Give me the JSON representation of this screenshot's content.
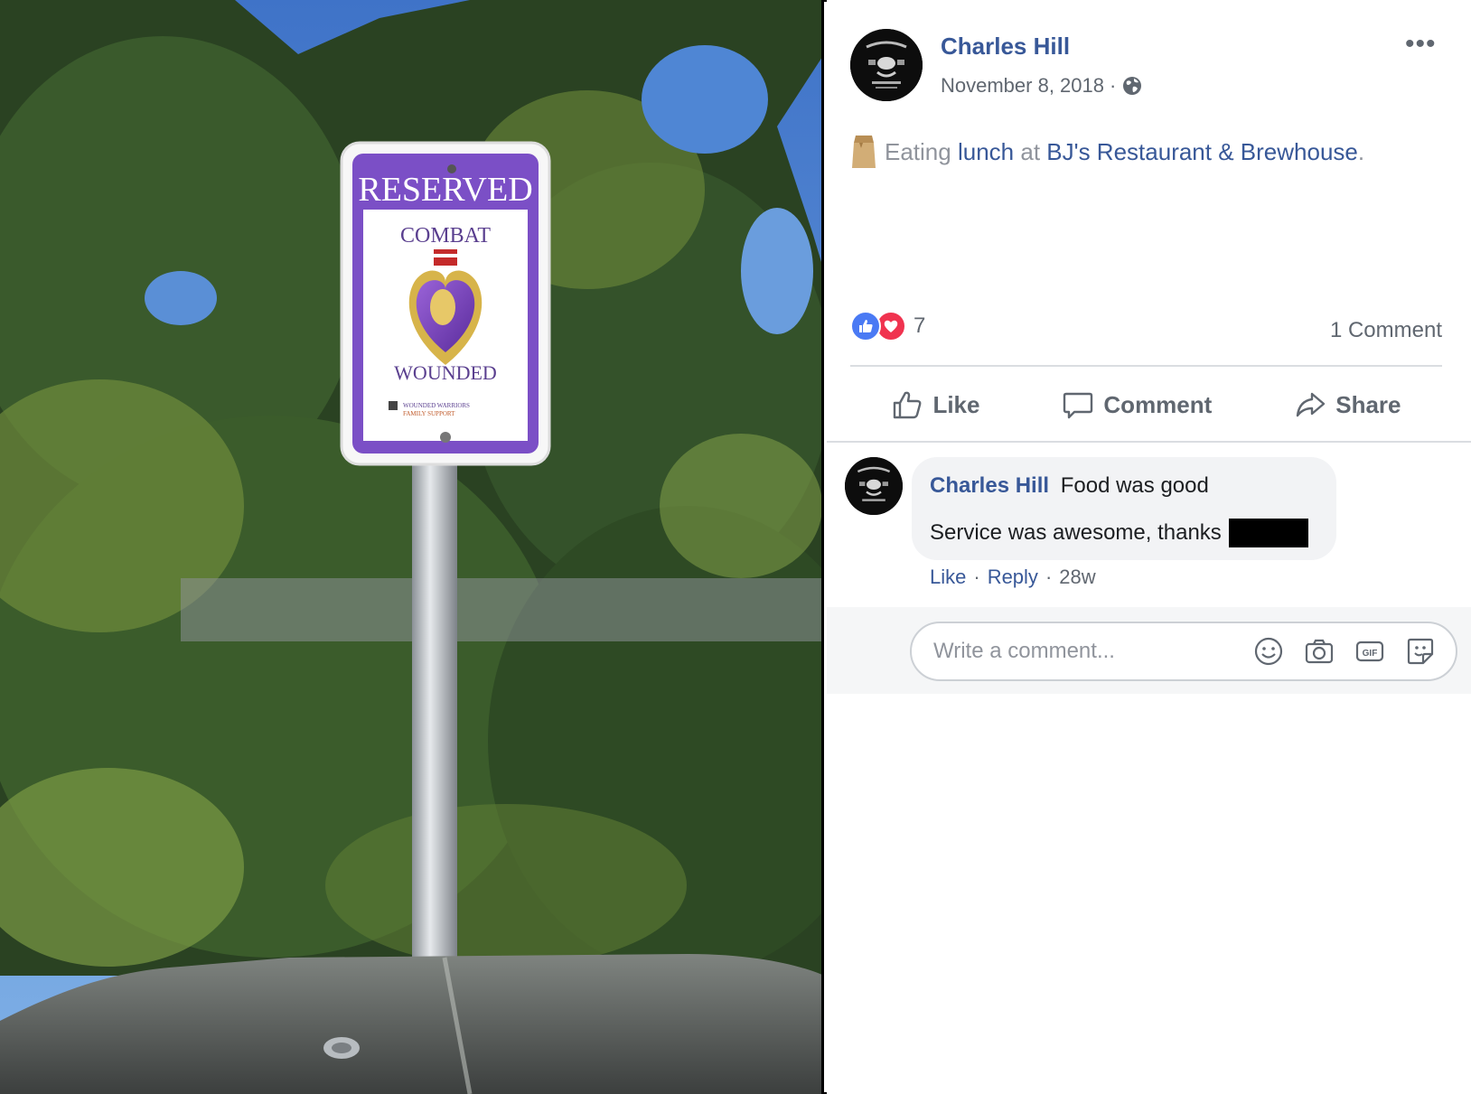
{
  "photo": {
    "sign_title": "RESERVED",
    "sign_line1": "COMBAT",
    "sign_line2": "WOUNDED",
    "sign_footer_1": "WOUNDED WARRIORS",
    "sign_footer_2": "FAMILY SUPPORT",
    "colors": {
      "sign_purple": "#7b4fc6",
      "sky": "#5a8fd0",
      "tree": "#2f4a25"
    }
  },
  "post": {
    "author": "Charles Hill",
    "date": "November 8, 2018",
    "date_separator": "·",
    "audience_icon": "globe-icon",
    "more_label": "•••",
    "status": {
      "activity": "Eating",
      "object": "lunch",
      "connector": "at",
      "place": "BJ's Restaurant & Brewhouse",
      "end": "."
    },
    "reaction_count": "7",
    "comment_count": "1 Comment",
    "actions": {
      "like": "Like",
      "comment": "Comment",
      "share": "Share"
    }
  },
  "comment": {
    "author": "Charles Hill",
    "text_line1": "Food was good",
    "text_line2": "Service was awesome, thanks",
    "like": "Like",
    "reply": "Reply",
    "age": "28w",
    "sep": "·"
  },
  "composer": {
    "placeholder": "Write a comment..."
  },
  "colors": {
    "link": "#385898",
    "muted": "#606770",
    "like_blue": "#4a7af4",
    "love_red": "#f0334f"
  }
}
